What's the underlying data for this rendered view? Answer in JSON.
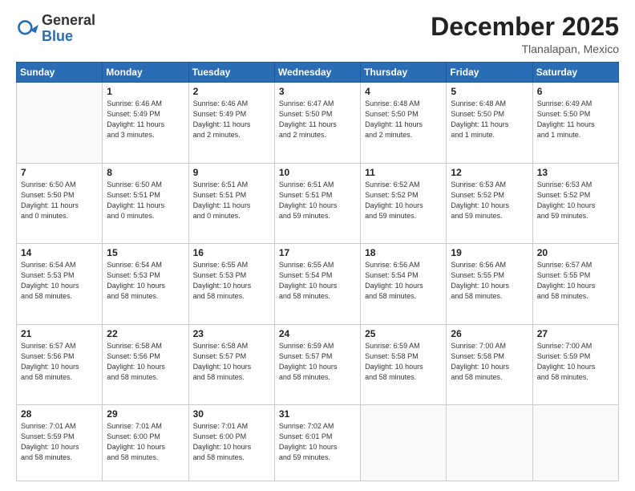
{
  "logo": {
    "general": "General",
    "blue": "Blue"
  },
  "title": "December 2025",
  "location": "Tlanalapan, Mexico",
  "days_header": [
    "Sunday",
    "Monday",
    "Tuesday",
    "Wednesday",
    "Thursday",
    "Friday",
    "Saturday"
  ],
  "weeks": [
    [
      {
        "day": "",
        "info": ""
      },
      {
        "day": "1",
        "info": "Sunrise: 6:46 AM\nSunset: 5:49 PM\nDaylight: 11 hours\nand 3 minutes."
      },
      {
        "day": "2",
        "info": "Sunrise: 6:46 AM\nSunset: 5:49 PM\nDaylight: 11 hours\nand 2 minutes."
      },
      {
        "day": "3",
        "info": "Sunrise: 6:47 AM\nSunset: 5:50 PM\nDaylight: 11 hours\nand 2 minutes."
      },
      {
        "day": "4",
        "info": "Sunrise: 6:48 AM\nSunset: 5:50 PM\nDaylight: 11 hours\nand 2 minutes."
      },
      {
        "day": "5",
        "info": "Sunrise: 6:48 AM\nSunset: 5:50 PM\nDaylight: 11 hours\nand 1 minute."
      },
      {
        "day": "6",
        "info": "Sunrise: 6:49 AM\nSunset: 5:50 PM\nDaylight: 11 hours\nand 1 minute."
      }
    ],
    [
      {
        "day": "7",
        "info": "Sunrise: 6:50 AM\nSunset: 5:50 PM\nDaylight: 11 hours\nand 0 minutes."
      },
      {
        "day": "8",
        "info": "Sunrise: 6:50 AM\nSunset: 5:51 PM\nDaylight: 11 hours\nand 0 minutes."
      },
      {
        "day": "9",
        "info": "Sunrise: 6:51 AM\nSunset: 5:51 PM\nDaylight: 11 hours\nand 0 minutes."
      },
      {
        "day": "10",
        "info": "Sunrise: 6:51 AM\nSunset: 5:51 PM\nDaylight: 10 hours\nand 59 minutes."
      },
      {
        "day": "11",
        "info": "Sunrise: 6:52 AM\nSunset: 5:52 PM\nDaylight: 10 hours\nand 59 minutes."
      },
      {
        "day": "12",
        "info": "Sunrise: 6:53 AM\nSunset: 5:52 PM\nDaylight: 10 hours\nand 59 minutes."
      },
      {
        "day": "13",
        "info": "Sunrise: 6:53 AM\nSunset: 5:52 PM\nDaylight: 10 hours\nand 59 minutes."
      }
    ],
    [
      {
        "day": "14",
        "info": "Sunrise: 6:54 AM\nSunset: 5:53 PM\nDaylight: 10 hours\nand 58 minutes."
      },
      {
        "day": "15",
        "info": "Sunrise: 6:54 AM\nSunset: 5:53 PM\nDaylight: 10 hours\nand 58 minutes."
      },
      {
        "day": "16",
        "info": "Sunrise: 6:55 AM\nSunset: 5:53 PM\nDaylight: 10 hours\nand 58 minutes."
      },
      {
        "day": "17",
        "info": "Sunrise: 6:55 AM\nSunset: 5:54 PM\nDaylight: 10 hours\nand 58 minutes."
      },
      {
        "day": "18",
        "info": "Sunrise: 6:56 AM\nSunset: 5:54 PM\nDaylight: 10 hours\nand 58 minutes."
      },
      {
        "day": "19",
        "info": "Sunrise: 6:56 AM\nSunset: 5:55 PM\nDaylight: 10 hours\nand 58 minutes."
      },
      {
        "day": "20",
        "info": "Sunrise: 6:57 AM\nSunset: 5:55 PM\nDaylight: 10 hours\nand 58 minutes."
      }
    ],
    [
      {
        "day": "21",
        "info": "Sunrise: 6:57 AM\nSunset: 5:56 PM\nDaylight: 10 hours\nand 58 minutes."
      },
      {
        "day": "22",
        "info": "Sunrise: 6:58 AM\nSunset: 5:56 PM\nDaylight: 10 hours\nand 58 minutes."
      },
      {
        "day": "23",
        "info": "Sunrise: 6:58 AM\nSunset: 5:57 PM\nDaylight: 10 hours\nand 58 minutes."
      },
      {
        "day": "24",
        "info": "Sunrise: 6:59 AM\nSunset: 5:57 PM\nDaylight: 10 hours\nand 58 minutes."
      },
      {
        "day": "25",
        "info": "Sunrise: 6:59 AM\nSunset: 5:58 PM\nDaylight: 10 hours\nand 58 minutes."
      },
      {
        "day": "26",
        "info": "Sunrise: 7:00 AM\nSunset: 5:58 PM\nDaylight: 10 hours\nand 58 minutes."
      },
      {
        "day": "27",
        "info": "Sunrise: 7:00 AM\nSunset: 5:59 PM\nDaylight: 10 hours\nand 58 minutes."
      }
    ],
    [
      {
        "day": "28",
        "info": "Sunrise: 7:01 AM\nSunset: 5:59 PM\nDaylight: 10 hours\nand 58 minutes."
      },
      {
        "day": "29",
        "info": "Sunrise: 7:01 AM\nSunset: 6:00 PM\nDaylight: 10 hours\nand 58 minutes."
      },
      {
        "day": "30",
        "info": "Sunrise: 7:01 AM\nSunset: 6:00 PM\nDaylight: 10 hours\nand 58 minutes."
      },
      {
        "day": "31",
        "info": "Sunrise: 7:02 AM\nSunset: 6:01 PM\nDaylight: 10 hours\nand 59 minutes."
      },
      {
        "day": "",
        "info": ""
      },
      {
        "day": "",
        "info": ""
      },
      {
        "day": "",
        "info": ""
      }
    ]
  ]
}
